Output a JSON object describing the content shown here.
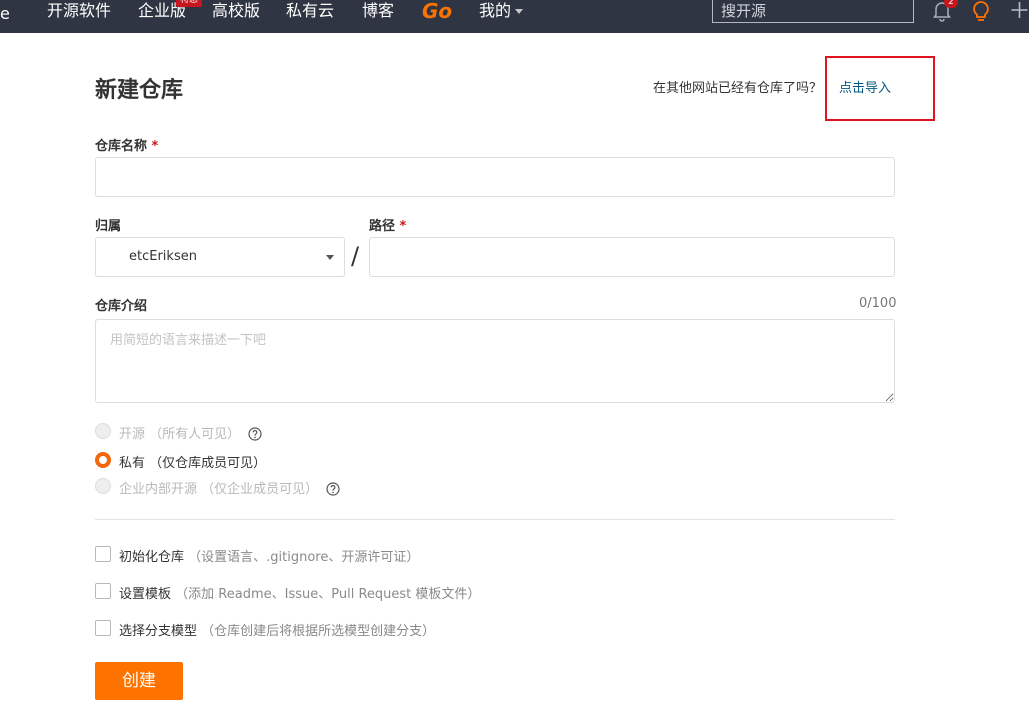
{
  "nav": {
    "edge_glyph": "e",
    "items": [
      "开源软件",
      "企业版",
      "高校版",
      "私有云",
      "博客"
    ],
    "enterprise_badge": "特惠",
    "go_label": "Go",
    "mine_label": "我的",
    "search_placeholder": "搜开源",
    "notification_count": "2",
    "icons": [
      "bell-icon",
      "lightbulb-icon",
      "plus-icon",
      "question-icon",
      "chevron-down-icon"
    ]
  },
  "page": {
    "title": "新建仓库",
    "import_tip": "在其他网站已经有仓库了吗？",
    "import_link": "点击导入",
    "highlight_color": "#e0141e",
    "accent_color": "#fe7300"
  },
  "form": {
    "name_label": "仓库名称",
    "required_mark": "*",
    "owner_label": "归属",
    "owner_value": "etcEriksen",
    "path_label": "路径",
    "path_separator": "/",
    "intro_label": "仓库介绍",
    "intro_counter": "0/100",
    "intro_placeholder": "用简短的语言来描述一下吧",
    "visibility": [
      {
        "label": "开源",
        "hint": "（所有人可见）",
        "selected": false,
        "disabled": true,
        "help": true
      },
      {
        "label": "私有",
        "hint": "（仅仓库成员可见）",
        "selected": true,
        "disabled": false,
        "help": false
      },
      {
        "label": "企业内部开源",
        "hint": "（仅企业成员可见）",
        "selected": false,
        "disabled": true,
        "help": true
      }
    ],
    "options": [
      {
        "label": "初始化仓库",
        "hint": "（设置语言、.gitignore、开源许可证）"
      },
      {
        "label": "设置模板",
        "hint": "（添加 Readme、Issue、Pull Request 模板文件）"
      },
      {
        "label": "选择分支模型",
        "hint": "（仓库创建后将根据所选模型创建分支）"
      }
    ],
    "submit_label": "创建"
  }
}
